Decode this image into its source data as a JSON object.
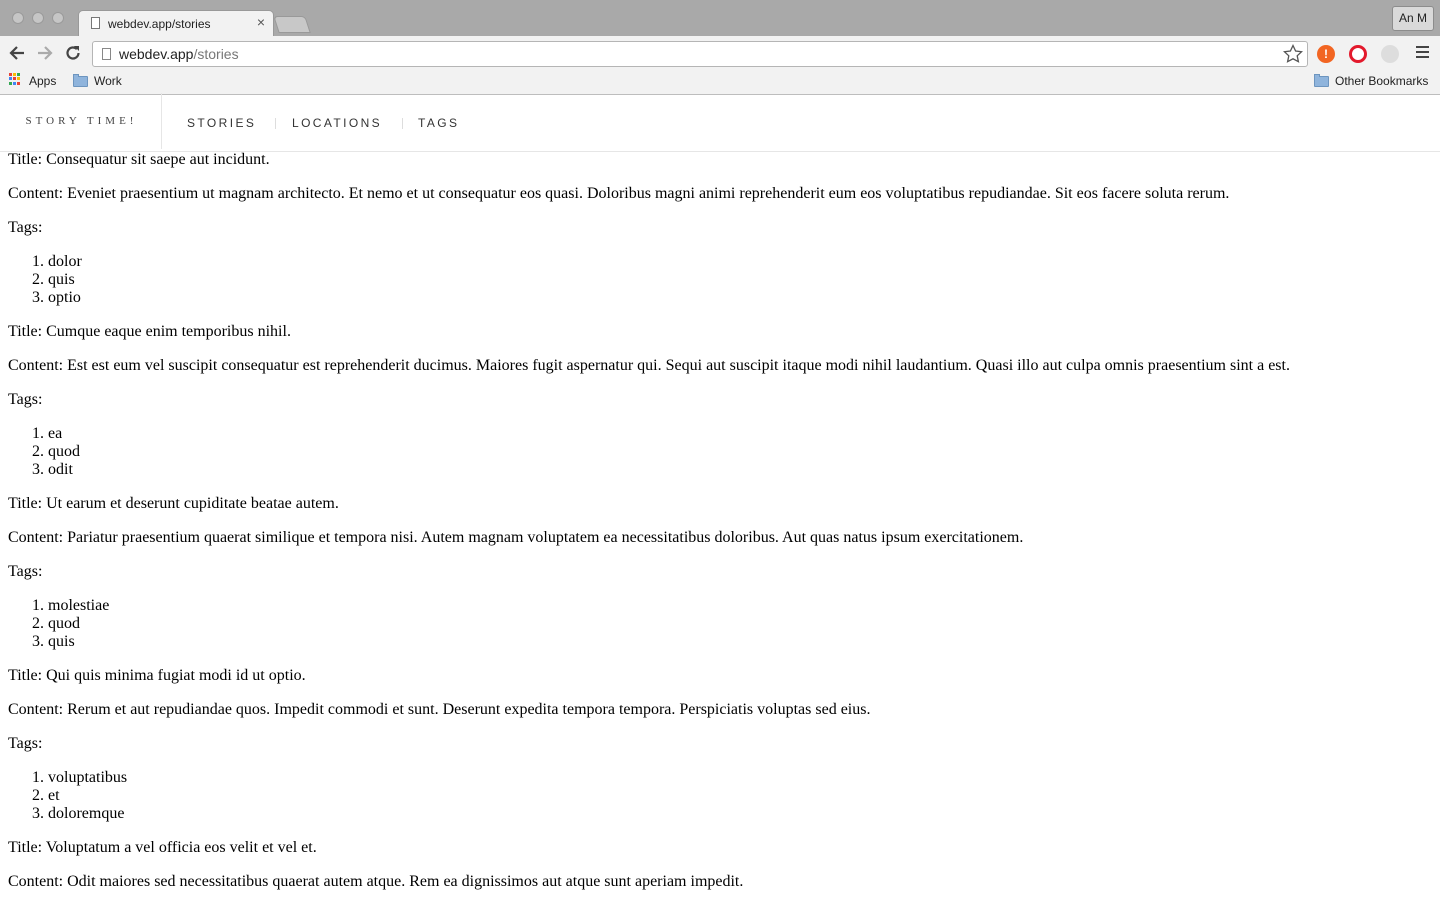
{
  "browser": {
    "tab_title": "webdev.app/stories",
    "tab_close": "×",
    "profile_name": "An M",
    "url_host": "webdev.app",
    "url_path": "/stories",
    "bookmarks": {
      "apps": "Apps",
      "work": "Work",
      "other": "Other Bookmarks"
    },
    "icons": {
      "back": "arrow-left-icon",
      "forward": "arrow-right-icon",
      "reload": "reload-icon",
      "star": "star-icon",
      "menu": "hamburger-menu-icon"
    }
  },
  "site": {
    "brand": "STORY TIME!",
    "nav": [
      "STORIES",
      "LOCATIONS",
      "TAGS"
    ]
  },
  "labels": {
    "title": "Title: ",
    "content": "Content: ",
    "tags": "Tags:"
  },
  "stories": [
    {
      "title": "Consequatur sit saepe aut incidunt.",
      "content": "Eveniet praesentium ut magnam architecto. Et nemo et ut consequatur eos quasi. Doloribus magni animi reprehenderit eum eos voluptatibus repudiandae. Sit eos facere soluta rerum.",
      "tags": [
        "dolor",
        "quis",
        "optio"
      ]
    },
    {
      "title": "Cumque eaque enim temporibus nihil.",
      "content": "Est est eum vel suscipit consequatur est reprehenderit ducimus. Maiores fugit aspernatur qui. Sequi aut suscipit itaque modi nihil laudantium. Quasi illo aut culpa omnis praesentium sint a est.",
      "tags": [
        "ea",
        "quod",
        "odit"
      ]
    },
    {
      "title": "Ut earum et deserunt cupiditate beatae autem.",
      "content": "Pariatur praesentium quaerat similique et tempora nisi. Autem magnam voluptatem ea necessitatibus doloribus. Aut quas natus ipsum exercitationem.",
      "tags": [
        "molestiae",
        "quod",
        "quis"
      ]
    },
    {
      "title": "Qui quis minima fugiat modi id ut optio.",
      "content": "Rerum et aut repudiandae quos. Impedit commodi et sunt. Deserunt expedita tempora tempora. Perspiciatis voluptas sed eius.",
      "tags": [
        "voluptatibus",
        "et",
        "doloremque"
      ]
    },
    {
      "title": "Voluptatum a vel officia eos velit et vel et.",
      "content": "Odit maiores sed necessitatibus quaerat autem atque. Rem ea dignissimos aut atque sunt aperiam impedit.",
      "tags": []
    }
  ]
}
